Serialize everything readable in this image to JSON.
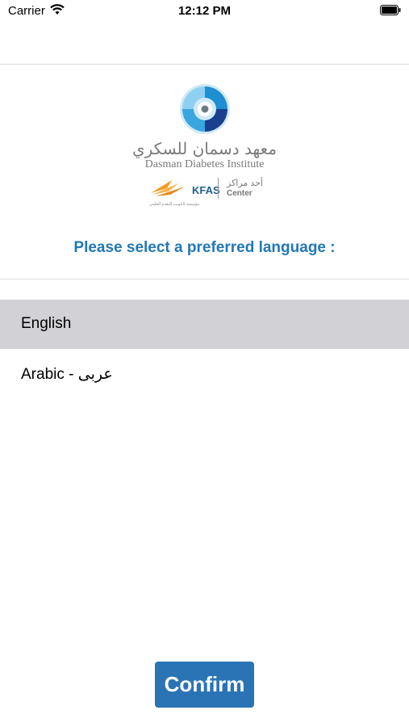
{
  "status_bar": {
    "carrier": "Carrier",
    "time": "12:12 PM"
  },
  "logo": {
    "arabic_name": "معهد دسمان للسكري",
    "english_name": "Dasman Diabetes Institute",
    "kfas_label": "KFAS",
    "center_ar": "أحد مراكز",
    "center_en": "Center",
    "kfas_small_text": "مؤسسة الكويت للتقدم العلمي"
  },
  "prompt": "Please select a preferred language :",
  "languages": [
    {
      "label": "English",
      "selected": true
    },
    {
      "label": "Arabic - عربى",
      "selected": false
    }
  ],
  "confirm_label": "Confirm",
  "colors": {
    "accent": "#2378b5",
    "button": "#2a74b5",
    "selected_row": "#d1d1d6"
  }
}
